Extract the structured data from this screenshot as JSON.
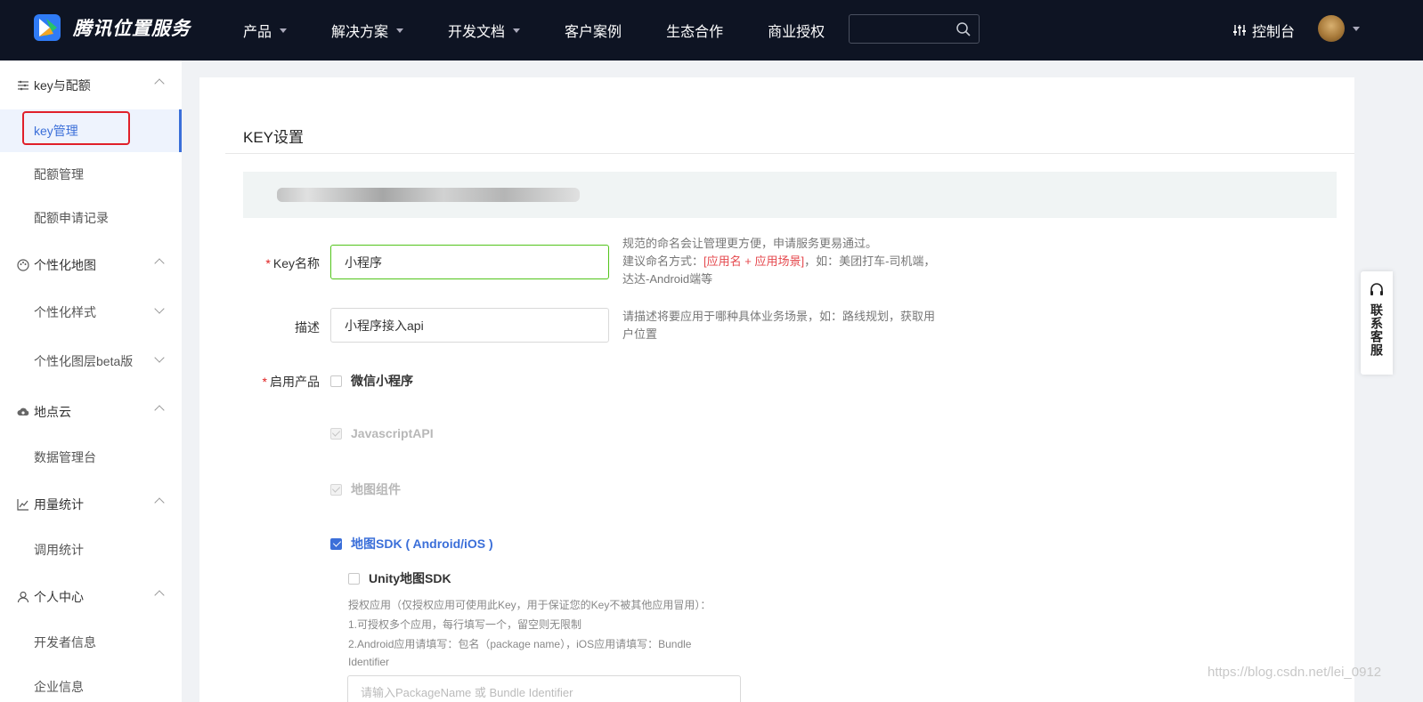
{
  "header": {
    "brand": "腾讯位置服务",
    "nav": [
      {
        "label": "产品",
        "dropdown": true
      },
      {
        "label": "解决方案",
        "dropdown": true
      },
      {
        "label": "开发文档",
        "dropdown": true
      },
      {
        "label": "客户案例",
        "dropdown": false
      },
      {
        "label": "生态合作",
        "dropdown": false
      },
      {
        "label": "商业授权",
        "dropdown": false
      }
    ],
    "search_value": "",
    "console_label": "控制台"
  },
  "sidebar": {
    "groups": {
      "key_quota": "key与配额",
      "custom_map": "个性化地图",
      "place_cloud": "地点云",
      "usage": "用量统计",
      "personal": "个人中心"
    },
    "items": {
      "key_manage": "key管理",
      "quota_manage": "配额管理",
      "quota_apply_log": "配额申请记录",
      "custom_style": "个性化样式",
      "custom_layer_beta": "个性化图层beta版",
      "data_console": "数据管理台",
      "call_stats": "调用统计",
      "developer_info": "开发者信息",
      "company_info": "企业信息"
    }
  },
  "main": {
    "title": "KEY设置",
    "form": {
      "key_name_label": "Key名称",
      "key_name_value": "小程序",
      "key_name_hint_1": "规范的命名会让管理更方便，申请服务更易通过。",
      "key_name_hint_2": "建议命名方式：",
      "key_name_hint_red": "[应用名 + 应用场景]",
      "key_name_hint_3": "，如：美团打车-司机端，达达-Android端等",
      "desc_label": "描述",
      "desc_value": "小程序接入api",
      "desc_hint": "请描述将要应用于哪种具体业务场景，如：路线规划，获取用户位置",
      "products_label": "启用产品",
      "required_mark": "*"
    },
    "products": [
      {
        "label": "微信小程序",
        "state": "unchecked"
      },
      {
        "label": "JavascriptAPI",
        "state": "disabled-checked"
      },
      {
        "label": "地图组件",
        "state": "disabled-checked"
      },
      {
        "label": "地图SDK ( Android/iOS )",
        "state": "checked"
      },
      {
        "label": "Unity地图SDK",
        "state": "unchecked"
      }
    ],
    "auth": {
      "line1": "授权应用（仅授权应用可使用此Key，用于保证您的Key不被其他应用冒用）：",
      "line2": "1.可授权多个应用，每行填写一个，留空则无限制",
      "line3": "2.Android应用请填写：包名（package name），iOS应用请填写：Bundle",
      "line4": "Identifier",
      "placeholder": "请输入PackageName 或 Bundle Identifier"
    }
  },
  "floating": {
    "contact_label": "联系客服"
  },
  "watermark": "https://blog.csdn.net/lei_0912",
  "colors": {
    "topbar": "#0e1423",
    "accent": "#3b6fd9",
    "highlight_box": "#e0202a",
    "valid_border": "#52c41a"
  }
}
